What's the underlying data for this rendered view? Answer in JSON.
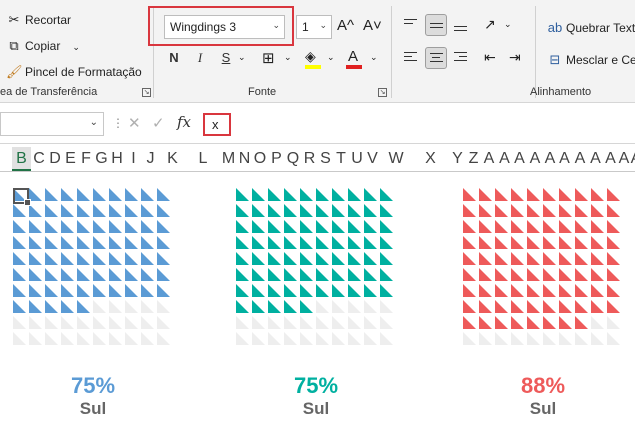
{
  "ribbon": {
    "clipboard": {
      "cut_label": "Recortar",
      "copy_label": "Copiar",
      "format_painter_label": "Pincel de Formatação",
      "group_label": "ea de Transferência"
    },
    "font": {
      "font_name": "Wingdings 3",
      "font_size": "1",
      "grow_label": "A^",
      "shrink_label": "A˅",
      "bold_label": "N",
      "italic_label": "I",
      "underline_label": "S",
      "group_label": "Fonte"
    },
    "alignment": {
      "wrap_text_label": "Quebrar Text",
      "merge_label": "Mesclar e Ce",
      "group_label": "Alinhamento"
    }
  },
  "formula_bar": {
    "name_box_value": "",
    "fx_label": "fx",
    "formula_value": "x"
  },
  "columns": [
    "B",
    "C",
    "D",
    "E",
    "F",
    "G",
    "H",
    "I",
    "J",
    "K",
    "L",
    "M",
    "N",
    "O",
    "P",
    "Q",
    "R",
    "S",
    "T",
    "U",
    "V",
    "W",
    "X",
    "Y",
    "Z",
    "A",
    "A",
    "A",
    "A",
    "A",
    "A",
    "A",
    "A",
    "A",
    "A",
    "A",
    "A",
    "A",
    "A"
  ],
  "selected_column": "B",
  "charts": [
    {
      "percent": 0.75,
      "percent_label": "75%",
      "label": "Sul",
      "color": "#5b9bd5"
    },
    {
      "percent": 0.75,
      "percent_label": "75%",
      "label": "Sul",
      "color": "#00b0a0"
    },
    {
      "percent": 0.88,
      "percent_label": "88%",
      "label": "Sul",
      "color": "#ee5a5a"
    }
  ],
  "empty_color": "#eeeeee",
  "label_color": "#666666"
}
